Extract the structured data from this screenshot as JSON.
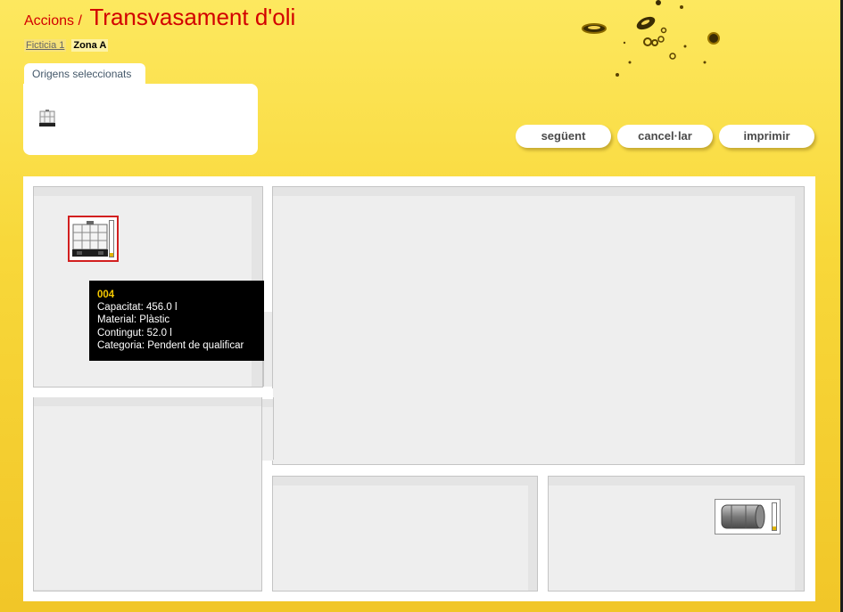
{
  "header": {
    "parent": "Accions",
    "separator": "/",
    "title": "Transvasament d'oli"
  },
  "sub_tabs": {
    "link": "Ficticia 1",
    "active": "Zona A"
  },
  "origins": {
    "tab_label": "Origens seleccionats",
    "item_icon": "ibc-container-icon"
  },
  "buttons": {
    "next": "següent",
    "cancel": "cancel·lar",
    "print": "imprimir"
  },
  "tanks": [
    {
      "name": "004",
      "icon": "ibc-container-icon",
      "selected": true,
      "level": 0.11
    },
    {
      "icon": "metal-drum-icon",
      "selected": false,
      "level": 0.12
    }
  ],
  "tooltip": {
    "id": "004",
    "capacity": "Capacitat: 456.0 l",
    "material": "Material: Plàstic",
    "content": "Contingut: 52.0 l",
    "category": "Categoria: Pendent de qualificar"
  },
  "colors": {
    "title_red": "#d20000",
    "accent_yellow": "#f5c800",
    "selected_border": "#d21f1f"
  }
}
